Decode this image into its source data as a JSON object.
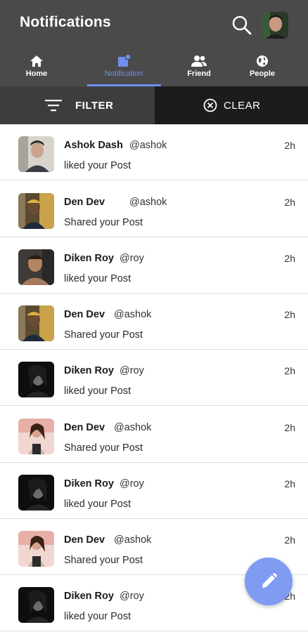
{
  "header": {
    "title": "Notifications",
    "search_icon": "search-icon",
    "avatar": "user-avatar"
  },
  "tabs": [
    {
      "label": "Home",
      "icon": "home-icon",
      "active": false
    },
    {
      "label": "Notification",
      "icon": "notification-icon",
      "active": true
    },
    {
      "label": "Friend",
      "icon": "friend-icon",
      "active": false
    },
    {
      "label": "People",
      "icon": "globe-icon",
      "active": false
    }
  ],
  "filter": {
    "label": "FILTER",
    "icon": "filter-lines-icon"
  },
  "clear": {
    "label": "CLEAR",
    "icon": "close-circle-icon"
  },
  "notifications": [
    {
      "name": "Ashok Dash",
      "handle": "@ashok",
      "action": "liked your Post",
      "time": "2h"
    },
    {
      "name": "Den Dev",
      "handle": "@ashok",
      "action": "Shared your Post",
      "time": "2h"
    },
    {
      "name": "Diken Roy",
      "handle": "@roy",
      "action": "liked your Post",
      "time": "2h"
    },
    {
      "name": "Den Dev",
      "handle": "@ashok",
      "action": "Shared your Post",
      "time": "2h"
    },
    {
      "name": "Diken Roy",
      "handle": "@roy",
      "action": "liked your Post",
      "time": "2h"
    },
    {
      "name": "Den Dev",
      "handle": "@ashok",
      "action": "Shared your Post",
      "time": "2h"
    },
    {
      "name": "Diken Roy",
      "handle": "@roy",
      "action": "liked your Post",
      "time": "2h"
    },
    {
      "name": "Den Dev",
      "handle": "@ashok",
      "action": "Shared your Post",
      "time": "2h"
    },
    {
      "name": "Diken Roy",
      "handle": "@roy",
      "action": "liked your Post",
      "time": "2h"
    }
  ],
  "fab": {
    "icon": "pencil-icon"
  },
  "colors": {
    "appbar": "#4a4a4a",
    "accent": "#6e8ef0",
    "fab": "#7f9cf2",
    "filter_bg": "#3d3d3d",
    "clear_bg": "#1c1c1c"
  }
}
